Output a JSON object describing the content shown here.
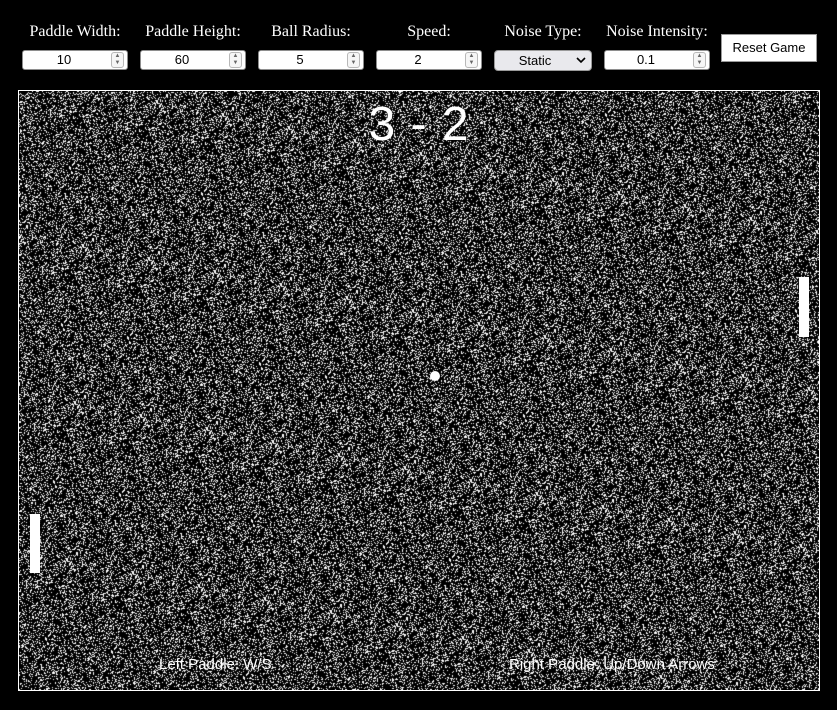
{
  "controls": {
    "paddle_width": {
      "label": "Paddle Width:",
      "value": "10"
    },
    "paddle_height": {
      "label": "Paddle Height:",
      "value": "60"
    },
    "ball_radius": {
      "label": "Ball Radius:",
      "value": "5"
    },
    "speed": {
      "label": "Speed:",
      "value": "2"
    },
    "noise_type": {
      "label": "Noise Type:",
      "value": "Static"
    },
    "noise_intensity": {
      "label": "Noise Intensity:",
      "value": "0.1"
    },
    "reset_label": "Reset Game"
  },
  "game": {
    "score_text": "3 - 2",
    "left_hint": "Left Paddle: W/S",
    "right_hint": "Right Paddle: Up/Down Arrows"
  },
  "colors": {
    "background": "#000000",
    "foreground": "#ffffff"
  }
}
